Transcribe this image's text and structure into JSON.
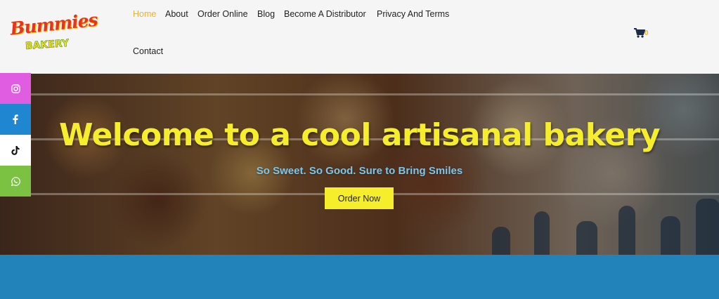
{
  "brand": {
    "logo_word": "Bummies",
    "logo_sub": "BAKERY"
  },
  "nav": {
    "items": [
      {
        "label": "Home",
        "active": true
      },
      {
        "label": "About"
      },
      {
        "label": "Order Online"
      },
      {
        "label": "Blog"
      },
      {
        "label": "Become A Distributor"
      },
      {
        "label": "Privacy And Terms"
      },
      {
        "label": "Contact"
      }
    ]
  },
  "cart": {
    "icon": "cart-icon",
    "count": "0"
  },
  "hero": {
    "title": "Welcome to a cool artisanal bakery",
    "subtitle": "So Sweet. So Good. Sure to Bring Smiles",
    "button_label": "Order Now"
  },
  "social": [
    {
      "icon": "instagram-icon",
      "color": "#e05ce0"
    },
    {
      "icon": "facebook-icon",
      "color": "#1f86d2"
    },
    {
      "icon": "tiktok-icon",
      "color": "#ffffff"
    },
    {
      "icon": "whatsapp-icon",
      "color": "#7cc242"
    }
  ],
  "colors": {
    "accent": "#e8b428",
    "hero_title": "#f6ee2a",
    "band": "#2283bb"
  }
}
